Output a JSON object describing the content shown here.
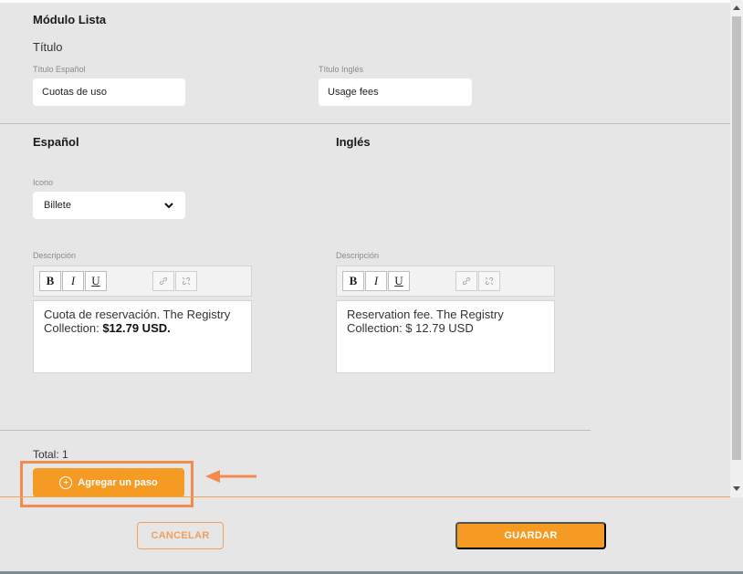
{
  "module": {
    "title": "Módulo Lista",
    "titulo_label": "Título",
    "titulo_es_label": "Título Español",
    "titulo_es_value": "Cuotas de uso",
    "titulo_en_label": "Título Inglés",
    "titulo_en_value": "Usage fees"
  },
  "spanish": {
    "heading": "Español",
    "icon_label": "Icono",
    "icon_selected": "Billete",
    "desc_label": "Descripción",
    "desc_text": "Cuota de reservación. The Registry Collection: ",
    "desc_bold": "$12.79 USD."
  },
  "english": {
    "heading": "Inglés",
    "desc_label": "Descripción",
    "desc_text": "Reservation fee. The Registry Collection: $ 12.79 USD"
  },
  "toolbar": {
    "bold": "B",
    "italic": "I",
    "underline": "U"
  },
  "steps": {
    "total": "Total: 1",
    "add_label": "Agregar un paso",
    "add_icon": "+"
  },
  "footer": {
    "cancel_label": "CANCELAR",
    "save_label": "GUARDAR"
  },
  "colors": {
    "accent": "#f59a23",
    "highlight": "#f58a4e"
  }
}
